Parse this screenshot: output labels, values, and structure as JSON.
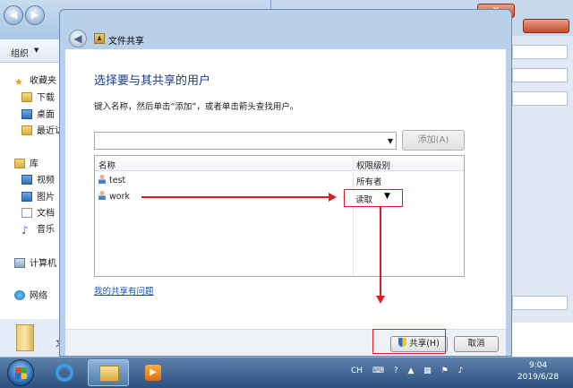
{
  "explorer": {
    "toolbar_organize": "组织",
    "nav": [
      {
        "label": "收藏夹",
        "icon": "star-icon"
      },
      {
        "label": "下载",
        "icon": "download-folder-icon"
      },
      {
        "label": "桌面",
        "icon": "desktop-icon"
      },
      {
        "label": "最近访",
        "icon": "recent-places-icon"
      },
      {
        "label": "库",
        "icon": "library-icon"
      },
      {
        "label": "视频",
        "icon": "video-icon"
      },
      {
        "label": "图片",
        "icon": "pictures-icon"
      },
      {
        "label": "文档",
        "icon": "documents-icon"
      },
      {
        "label": "音乐",
        "icon": "music-icon"
      },
      {
        "label": "计算机",
        "icon": "computer-icon"
      },
      {
        "label": "网络",
        "icon": "network-icon"
      }
    ],
    "status_text": "文"
  },
  "dialog": {
    "title": "文件共享",
    "heading": "选择要与其共享的用户",
    "instruction": "键入名称，然后单击“添加”，或者单击箭头查找用户。",
    "name_input_value": "",
    "add_button": "添加(A)",
    "columns": {
      "name": "名称",
      "permission": "权限级别"
    },
    "users": [
      {
        "name": "test",
        "permission": "所有者"
      },
      {
        "name": "work",
        "permission": "读取"
      }
    ],
    "problem_link": "我的共享有问题",
    "share_button": "共享(H)",
    "cancel_button": "取消"
  },
  "taskbar": {
    "ime": "CH",
    "time": "9:04",
    "date": "2019/6/28"
  },
  "colors": {
    "annotation_red": "#e11d24",
    "heading_blue": "#1a3e8a",
    "link_blue": "#1b4fb5"
  }
}
